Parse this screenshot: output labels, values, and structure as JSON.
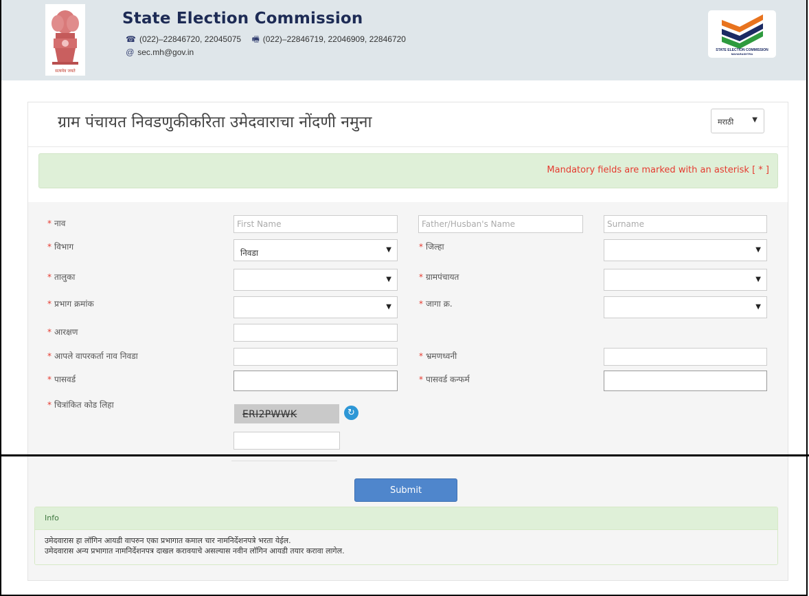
{
  "header": {
    "org_name": "State Election Commission",
    "phone": "(022)–22846720, 22045075",
    "fax": "(022)–22846719, 22046909, 22846720",
    "email": "sec.mh@gov.in",
    "emblem_motto": "सत्यमेव जयते",
    "logo_line1": "STATE ELECTION COMMISSION",
    "logo_line2": "MAHARASHTRA",
    "logo_colors": {
      "saffron": "#e8731e",
      "green": "#2e9a3e",
      "navy": "#1b2a63"
    }
  },
  "form": {
    "title": "ग्राम पंचायत निवडणुकीकरिता उमेदवाराचा नोंदणी नमुना",
    "language": "मराठी",
    "mandatory_note": "Mandatory fields are marked with an asterisk [ * ]",
    "asterisk": "*",
    "labels": {
      "name": "नाव",
      "division": "विभाग",
      "district": "जिल्हा",
      "taluka": "तालुका",
      "gram_panchayat": "ग्रामपंचायत",
      "ward_number": "प्रभाग क्रमांक",
      "seat_number": "जागा क्र.",
      "reservation": "आरक्षण",
      "username": "आपले वापरकर्ता नाव निवडा",
      "mobile": "भ्रमणध्वनी",
      "password": "पासवर्ड",
      "password_confirm": "पासवर्ड कन्फर्म",
      "captcha": "चित्रांकित कोड लिहा"
    },
    "placeholders": {
      "first_name": "First Name",
      "father_husband_name": "Father/Husban's Name",
      "surname": "Surname"
    },
    "values": {
      "division": "निवडा",
      "district": "",
      "taluka": "",
      "gram_panchayat": "",
      "ward_number": "",
      "seat_number": ""
    },
    "captcha_code": "ERI2PWWK",
    "submit_label": "Submit"
  },
  "info": {
    "title": "Info",
    "lines": [
      "उमेदवारास हा लॉगिन आयडी वापरुन एका प्रभागात कमाल चार नामनिर्देशनपत्रे भरता येईल.",
      "उमेदवारास अन्य प्रभागात नामनिर्देशनपत्र दाखल करावयाचे असल्यास नवीन लॉगिन आयडी तयार करावा लागेल."
    ]
  },
  "colors": {
    "header_bg": "#dfe6ea",
    "title_navy": "#1d2b55",
    "alert_bg": "#dff0d8",
    "required_red": "#e53a2f",
    "submit_blue": "#4f86cc"
  },
  "icons": {
    "phone": "telephone-icon",
    "fax": "fax-icon",
    "email": "at-sign-icon",
    "refresh": "refresh-captcha-icon",
    "dropdown": "caret-down-icon"
  }
}
